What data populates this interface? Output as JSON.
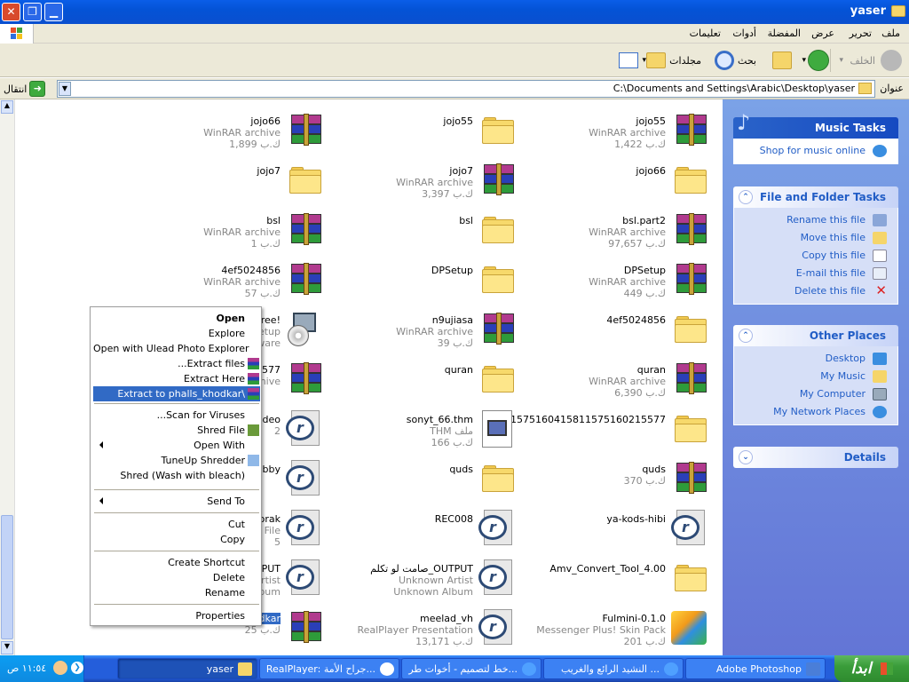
{
  "window": {
    "title": "yaser"
  },
  "menubar": {
    "items": [
      "ملف",
      "تحرير",
      "عرض",
      "المفضلة",
      "أدوات",
      "تعليمات"
    ]
  },
  "toolbar": {
    "back": "الخلف",
    "search": "بحث",
    "folders": "مجلدات"
  },
  "address": {
    "label": "عنوان",
    "value": "C:\\Documents and Settings\\Arabic\\Desktop\\yaser",
    "go": "انتقال"
  },
  "files": {
    "col1": [
      {
        "name": "jojo55",
        "type": "WinRAR archive",
        "size": "1,422 ك.ب",
        "icon": "rar"
      },
      {
        "name": "jojo66",
        "type": "",
        "size": "",
        "icon": "folder"
      },
      {
        "name": "bsl.part2",
        "type": "WinRAR archive",
        "size": "97,657 ك.ب",
        "icon": "rar"
      },
      {
        "name": "DPSetup",
        "type": "WinRAR archive",
        "size": "449 ك.ب",
        "icon": "rar"
      },
      {
        "name": "4ef5024856",
        "type": "",
        "size": "",
        "icon": "folder"
      },
      {
        "name": "quran",
        "type": "WinRAR archive",
        "size": "6,390 ك.ب",
        "icon": "rar"
      },
      {
        "name": "1575160415811575160215577",
        "type": "",
        "size": "",
        "icon": "folder"
      },
      {
        "name": "quds",
        "type": "",
        "size": "370 ك.ب",
        "icon": "rar"
      },
      {
        "name": "ya-kods-hibi",
        "type": "",
        "size": "",
        "icon": "real"
      },
      {
        "name": "Amv_Convert_Tool_4.00",
        "type": "",
        "size": "",
        "icon": "folder"
      },
      {
        "name": "Fulmini-0.1.0",
        "type": "Messenger Plus! Skin Pack",
        "size": "201 ك.ب",
        "icon": "msgr"
      }
    ],
    "col2": [
      {
        "name": "jojo55",
        "type": "",
        "size": "",
        "icon": "folder"
      },
      {
        "name": "jojo7",
        "type": "WinRAR archive",
        "size": "3,397 ك.ب",
        "icon": "rar"
      },
      {
        "name": "bsl",
        "type": "",
        "size": "",
        "icon": "folder"
      },
      {
        "name": "DPSetup",
        "type": "",
        "size": "",
        "icon": "folder"
      },
      {
        "name": "n9ujiasa",
        "type": "WinRAR archive",
        "size": "39 ك.ب",
        "icon": "rar"
      },
      {
        "name": "quran",
        "type": "",
        "size": "",
        "icon": "folder"
      },
      {
        "name": "sonyt_66.thm",
        "type": "THM ملف",
        "size": "166 ك.ب",
        "icon": "thm"
      },
      {
        "name": "quds",
        "type": "",
        "size": "",
        "icon": "folder"
      },
      {
        "name": "REC008",
        "type": "",
        "size": "",
        "icon": "real"
      },
      {
        "name": "صامت لو تكلم_OUTPUT",
        "type": "Unknown Artist",
        "size": "Unknown Album",
        "icon": "real"
      },
      {
        "name": "meelad_vh",
        "type": "RealPlayer Presentation",
        "size": "13,171 ك.ب",
        "icon": "real"
      }
    ],
    "col3": [
      {
        "name": "jojo66",
        "type": "WinRAR archive",
        "size": "1,899 ك.ب",
        "icon": "rar"
      },
      {
        "name": "jojo7",
        "type": "",
        "size": "",
        "icon": "folder"
      },
      {
        "name": "bsl",
        "type": "WinRAR archive",
        "size": "1 ك.ب",
        "icon": "rar"
      },
      {
        "name": "4ef5024856",
        "type": "WinRAR archive",
        "size": "57 ك.ب",
        "icon": "rar"
      },
      {
        "name": "Free!",
        "type": "Setup",
        "size": "ware",
        "icon": "setup"
      },
      {
        "name": "1577",
        "type": "hive",
        "size": "",
        "icon": "rar"
      },
      {
        "name": "Video",
        "type": "2",
        "size": "",
        "icon": "real"
      },
      {
        "name": "hebby",
        "type": "",
        "size": "",
        "icon": "real"
      },
      {
        "name": "borak",
        "type": "o File",
        "size": "5",
        "icon": "real"
      },
      {
        "name": "OUTPUT",
        "type": "Artist",
        "size": "Album",
        "icon": "real"
      },
      {
        "name": "phalls_khodkar",
        "type": "",
        "size": "25 ك.ب",
        "icon": "rar"
      }
    ]
  },
  "context_menu": {
    "items": [
      {
        "label": "Open",
        "bold": true
      },
      {
        "label": "Explore"
      },
      {
        "label": "Open with Ulead Photo Explorer"
      },
      {
        "label": "...Extract files"
      },
      {
        "label": "Extract Here"
      },
      {
        "label": "Extract to phalls_khodkar\\"
      },
      {
        "label": "...Scan for Viruses"
      },
      {
        "label": "Shred File"
      },
      {
        "label": "Open With"
      },
      {
        "label": "TuneUp Shredder"
      },
      {
        "label": "Shred (Wash with bleach)"
      },
      {
        "label": "Send To"
      },
      {
        "label": "Cut"
      },
      {
        "label": "Copy"
      },
      {
        "label": "Create Shortcut"
      },
      {
        "label": "Delete"
      },
      {
        "label": "Rename"
      },
      {
        "label": "Properties"
      }
    ]
  },
  "side_panel": {
    "music": {
      "title": "Music Tasks",
      "links": [
        "Shop for music online"
      ]
    },
    "file_folder": {
      "title": "File and Folder Tasks",
      "links": [
        "Rename this file",
        "Move this file",
        "Copy this file",
        "E-mail this file",
        "Delete this file"
      ]
    },
    "other": {
      "title": "Other Places",
      "links": [
        "Desktop",
        "My Music",
        "My Computer",
        "My Network Places"
      ]
    },
    "details": {
      "title": "Details"
    }
  },
  "taskbar": {
    "start": "ابدأ",
    "tasks": [
      "Adobe Photoshop",
      "النشيد الرائع والغريب ...",
      "خط لتصميم - أخوات طر...",
      "RealPlayer: جراح الأمة...",
      "yaser"
    ],
    "clock": "١١:٥٤ ص"
  },
  "colors": {
    "titlebar": "#0a5ee8",
    "sidepanel": "#6f8fe0",
    "highlight": "#316ac5",
    "taskbar": "#245edb",
    "start": "#3a9d3a"
  }
}
